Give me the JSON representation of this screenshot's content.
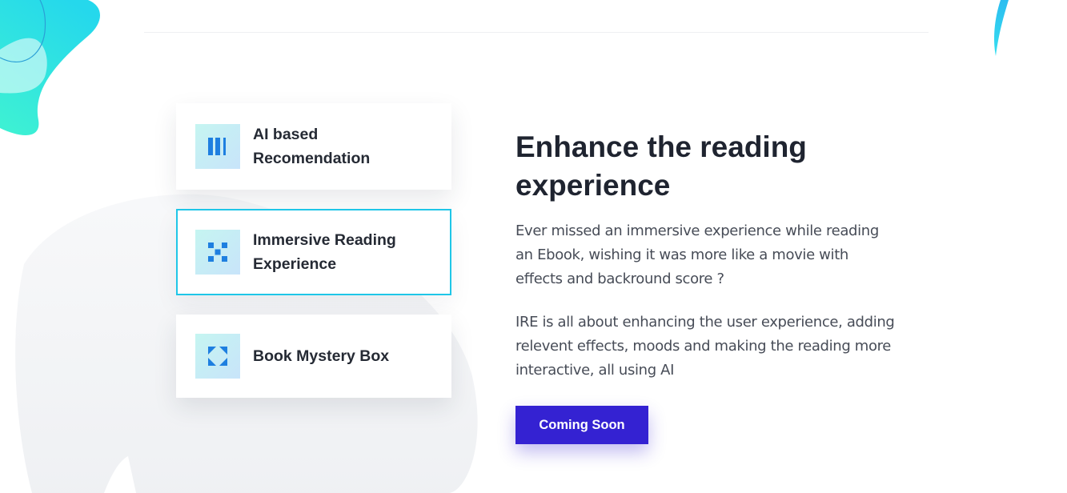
{
  "features": [
    {
      "label": "AI based Recomendation",
      "icon": "bars-icon",
      "active": false
    },
    {
      "label": "Immersive Reading Experience",
      "icon": "checker-icon",
      "active": true
    },
    {
      "label": "Book Mystery Box",
      "icon": "corners-icon",
      "active": false
    }
  ],
  "main": {
    "headline": "Enhance the reading experience",
    "paragraph_1": "Ever missed an immersive experience while reading an Ebook, wishing it was more like a movie with effects and backround score ?",
    "paragraph_2": "IRE is all about enhancing the user experience, adding relevent effects, moods and making the reading more interactive, all using AI",
    "cta_label": "Coming Soon"
  },
  "colors": {
    "accent_border": "#1fc6e8",
    "cta_background": "#3422d2",
    "icon_blue": "#1e7fe0",
    "blob_cyan": "#25d8ec",
    "blob_teal": "#3df0d4"
  }
}
